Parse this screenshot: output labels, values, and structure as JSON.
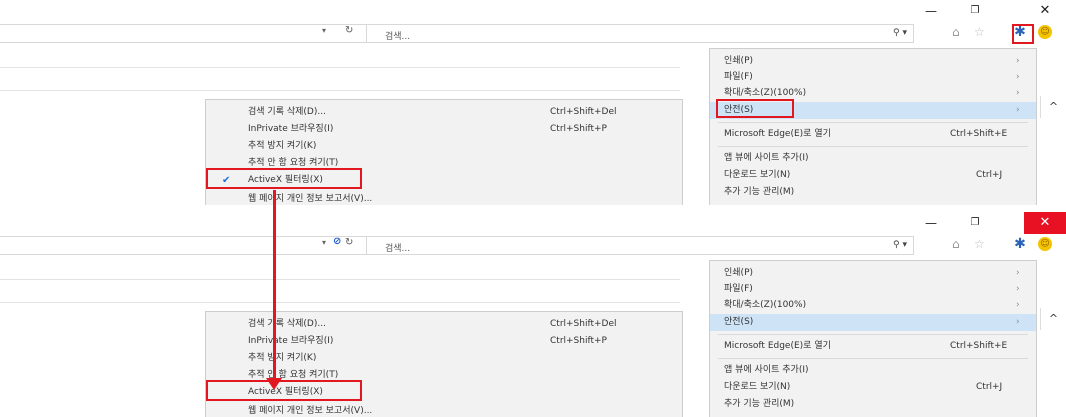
{
  "browser": {
    "search_placeholder": "검색...",
    "close_glyph": "✕",
    "minimize_glyph": "—",
    "restore_glyph": "❐"
  },
  "safety_menu": {
    "items": [
      {
        "label": "검색 기록 삭제(D)...",
        "shortcut": "Ctrl+Shift+Del"
      },
      {
        "label": "InPrivate 브라우징(I)",
        "shortcut": "Ctrl+Shift+P"
      },
      {
        "label": "추적 방지 켜기(K)",
        "shortcut": ""
      },
      {
        "label": "추적 안 함 요청 켜기(T)",
        "shortcut": ""
      },
      {
        "label": "ActiveX 필터링(X)",
        "shortcut": ""
      },
      {
        "label": "웹 페이지 개인 정보 보고서(V)...",
        "shortcut": ""
      }
    ]
  },
  "tools_menu": {
    "items": [
      {
        "label": "인쇄(P)",
        "shortcut": ""
      },
      {
        "label": "파일(F)",
        "shortcut": ""
      },
      {
        "label": "확대/축소(Z)(100%)",
        "shortcut": ""
      },
      {
        "label": "안전(S)",
        "shortcut": ""
      },
      {
        "label": "Microsoft Edge(E)로 열기",
        "shortcut": "Ctrl+Shift+E"
      },
      {
        "label": "앱 뷰에 사이트 추가(I)",
        "shortcut": ""
      },
      {
        "label": "다운로드 보기(N)",
        "shortcut": "Ctrl+J"
      },
      {
        "label": "추가 기능 관리(M)",
        "shortcut": ""
      }
    ]
  },
  "colors": {
    "highlight_red": "#e1181f",
    "menu_hover": "#cfe3f7",
    "close_red": "#e81123"
  },
  "icons": [
    "minimize-icon",
    "restore-icon",
    "close-icon",
    "stop-icon",
    "refresh-icon",
    "search-icon",
    "home-icon",
    "favorites-star-icon",
    "gear-icon",
    "smiley-feedback-icon",
    "checkmark-icon",
    "scroll-up-icon",
    "arrow-down-icon"
  ]
}
